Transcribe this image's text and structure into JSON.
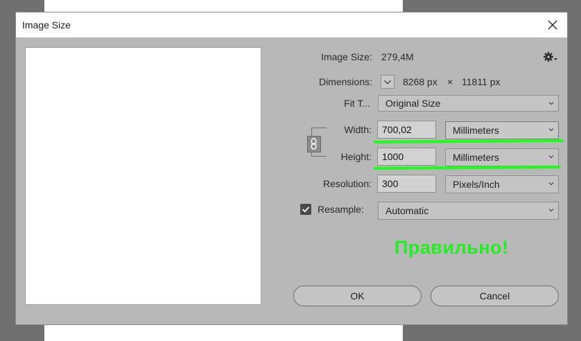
{
  "window": {
    "title": "Image Size"
  },
  "info": {
    "image_size_label": "Image Size:",
    "image_size_value": "279,4M",
    "dimensions_label": "Dimensions:",
    "dim_width": "8268 px",
    "dim_times": "×",
    "dim_height": "11811 px"
  },
  "fit_to": {
    "label": "Fit T...",
    "value": "Original Size"
  },
  "width": {
    "label": "Width:",
    "value": "700,02",
    "unit": "Millimeters"
  },
  "height": {
    "label": "Height:",
    "value": "1000",
    "unit": "Millimeters"
  },
  "resolution": {
    "label": "Resolution:",
    "value": "300",
    "unit": "Pixels/Inch"
  },
  "resample": {
    "label": "Resample:",
    "checked": true,
    "value": "Automatic"
  },
  "annotation": {
    "text": "Правильно!",
    "color": "#22ee22"
  },
  "buttons": {
    "ok": "OK",
    "cancel": "Cancel"
  },
  "icons": {
    "close": "close-icon",
    "gear": "gear-icon",
    "chevron": "chevron-down-icon",
    "link": "chain-link-icon",
    "check": "checkmark-icon"
  }
}
